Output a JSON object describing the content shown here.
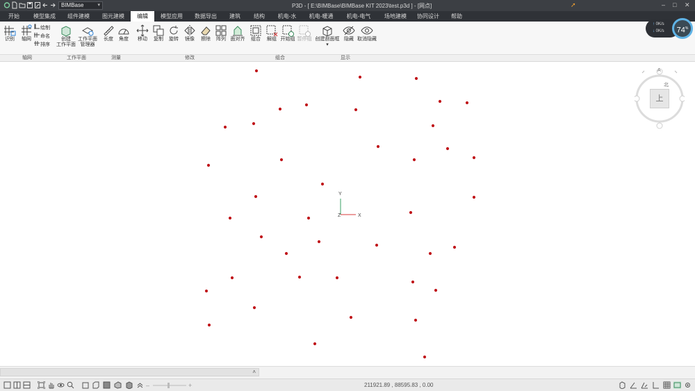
{
  "app": {
    "window_title": "P3D - [ E:\\BIMBase\\BIMBase KIT 2023\\test.p3d ] - [网点]",
    "project_select": "BIMBase"
  },
  "menu": {
    "tabs": [
      "开始",
      "模型集成",
      "组件建模",
      "图元建模",
      "编辑",
      "模型应用",
      "数据导出",
      "建筑",
      "结构",
      "机电-水",
      "机电-暖通",
      "机电-电气",
      "场地建模",
      "协同设计",
      "帮助"
    ],
    "active_tab": "编辑"
  },
  "ribbon": {
    "axis": {
      "identify": "识别",
      "grid": "轴网",
      "draw": "绘制",
      "name": "命名",
      "sort": "排序"
    },
    "workplane": {
      "create_line1": "创建",
      "create_line2": "工作平面",
      "manager_line1": "工作平面",
      "manager_line2": "管理器"
    },
    "measure": {
      "length": "长度",
      "angle": "角度"
    },
    "modify": {
      "move": "移动",
      "copy": "复制",
      "rotate": "旋转",
      "mirror": "镜像",
      "erase": "擦除",
      "array": "阵列",
      "align": "面对齐"
    },
    "combine": {
      "group": "组合",
      "ungroup": "解组",
      "start_group": "开始组",
      "pause_group": "暂停组"
    },
    "display": {
      "create_section_box": "创建剖面框",
      "hide": "隐藏",
      "unhide": "取消隐藏"
    },
    "groups": {
      "axis": "轴网",
      "workplane": "工作平面",
      "measure": "测量",
      "modify": "修改",
      "combine": "组合",
      "display": "显示"
    }
  },
  "hud": {
    "net_up": "0",
    "net_down": "0",
    "net_unit": "K/s",
    "cpu_value": "74",
    "cpu_unit": "%"
  },
  "viewcube": {
    "face": "上",
    "north": "北",
    "axis_a": "A"
  },
  "axes": {
    "x": "X",
    "y": "Y",
    "z": "Z"
  },
  "points": {
    "color": "#c0141a",
    "count_visible": 48
  },
  "status": {
    "coordinates": "211921.89 , 88595.83 , 0.00"
  },
  "colors": {
    "titlebar": "#3c3f44",
    "menubar": "#2f3237",
    "ribbon": "#f7f7f7",
    "accent": "#5fb3e6",
    "point": "#c0141a"
  }
}
